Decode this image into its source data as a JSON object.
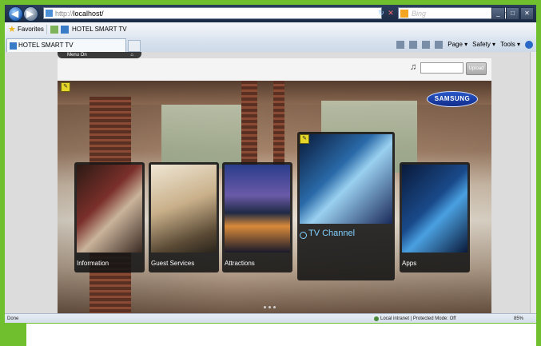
{
  "browser": {
    "url_protocol": "http://",
    "url_host": "localhost/",
    "search_placeholder": "Bing",
    "favorites_label": "Favorites",
    "favorites_link": "HOTEL SMART TV",
    "tab_title": "HOTEL SMART TV",
    "commands": [
      "Page ▾",
      "Safety ▾",
      "Tools ▾"
    ]
  },
  "app": {
    "menu_label": "Menu On",
    "home_glyph": "⌂",
    "upload_label": "Upload",
    "logo_text": "SAMSUNG",
    "cards": [
      {
        "label": "Information"
      },
      {
        "label": "Guest Services"
      },
      {
        "label": "Attractions"
      },
      {
        "label": "TV Channel"
      },
      {
        "label": "Apps"
      }
    ]
  },
  "status": {
    "done": "Done",
    "zone": "Local intranet | Protected Mode: Off",
    "zoom": "85%"
  }
}
